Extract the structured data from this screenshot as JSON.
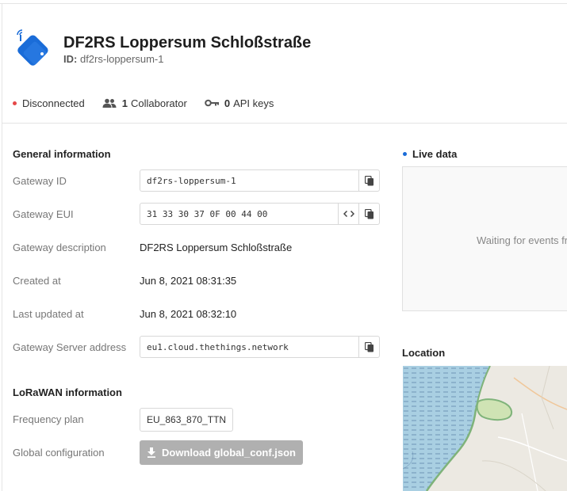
{
  "gateway": {
    "title": "DF2RS Loppersum Schloßstraße",
    "id_label": "ID:",
    "id_value": "df2rs-loppersum-1"
  },
  "status": {
    "connection": "Disconnected",
    "collaborators_count": "1",
    "collaborators_label": "Collaborator",
    "api_keys_count": "0",
    "api_keys_label": "API keys"
  },
  "general": {
    "title": "General information",
    "gateway_id_label": "Gateway ID",
    "gateway_id_value": "df2rs-loppersum-1",
    "gateway_eui_label": "Gateway EUI",
    "gateway_eui_value": "31 33 30 37 0F 00 44 00",
    "description_label": "Gateway description",
    "description_value": "DF2RS Loppersum Schloßstraße",
    "created_label": "Created at",
    "created_value": "Jun 8, 2021 08:31:35",
    "updated_label": "Last updated at",
    "updated_value": "Jun 8, 2021 08:32:10",
    "server_label": "Gateway Server address",
    "server_value": "eu1.cloud.thethings.network"
  },
  "lorawan": {
    "title": "LoRaWAN information",
    "frequency_label": "Frequency plan",
    "frequency_value": "EU_863_870_TTN",
    "global_conf_label": "Global configuration",
    "download_label": "Download global_conf.json"
  },
  "live": {
    "title": "Live data",
    "waiting_text": "Waiting for events fr"
  },
  "location": {
    "title": "Location"
  },
  "colors": {
    "disconnected": "#e54848",
    "live": "#1a6cd8",
    "gateway_icon": "#1a6cd8",
    "download_button": "#b0b0b0"
  },
  "icons": {
    "gateway": "gateway-icon",
    "collaborators": "people-icon",
    "api_keys": "key-icon",
    "copy": "copy-icon",
    "code": "code-icon",
    "download": "download-icon"
  }
}
